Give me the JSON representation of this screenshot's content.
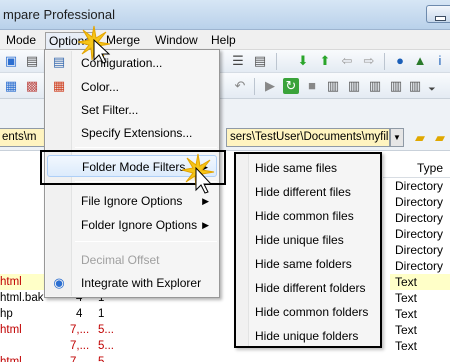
{
  "window": {
    "title": "mpare Professional"
  },
  "menubar": {
    "items": [
      {
        "label": "Mode",
        "active": false
      },
      {
        "label": "Options",
        "active": true
      },
      {
        "label": "Merge",
        "active": false
      },
      {
        "label": "Window",
        "active": false
      },
      {
        "label": "Help",
        "active": false
      }
    ]
  },
  "path": {
    "left": "ents\\m",
    "right": "sers\\TestUser\\Documents\\myfil"
  },
  "options_menu": {
    "items": [
      {
        "label": "Configuration...",
        "icon": "configuration-icon",
        "disabled": false
      },
      {
        "label": "Color...",
        "icon": "color-icon",
        "disabled": false
      },
      {
        "label": "Set Filter...",
        "icon": "",
        "disabled": false
      },
      {
        "label": "Specify Extensions...",
        "icon": "",
        "disabled": false
      },
      {
        "label": "Folder Mode Filters",
        "icon": "",
        "disabled": false,
        "submenu": true,
        "highlighted": true
      },
      {
        "label": "File Ignore Options",
        "icon": "",
        "disabled": false,
        "submenu": true
      },
      {
        "label": "Folder Ignore Options",
        "icon": "",
        "disabled": false,
        "submenu": true
      },
      {
        "label": "Decimal Offset",
        "icon": "",
        "disabled": true
      },
      {
        "label": "Integrate with Explorer",
        "icon": "explorer-integration-icon",
        "disabled": false
      }
    ]
  },
  "folder_mode_filters": {
    "items": [
      "Hide same files",
      "Hide different files",
      "Hide common files",
      "Hide unique files",
      "Hide same folders",
      "Hide different folders",
      "Hide common folders",
      "Hide unique folders"
    ]
  },
  "left_pane": {
    "rows": [
      {
        "name": "html",
        "col2": "",
        "col3": "",
        "color": "#c00000",
        "bg": "#ffffc8"
      },
      {
        "name": "html.bak",
        "col2": "4",
        "col3": "1",
        "color": "#000000",
        "bg": "#ffffff"
      },
      {
        "name": "hp",
        "col2": "4",
        "col3": "1",
        "color": "#000000",
        "bg": "#ffffff"
      },
      {
        "name": "html",
        "col2": "7,...",
        "col3": "5...",
        "color": "#c00000",
        "bg": "#ffffff"
      },
      {
        "name": "",
        "col2": "7,...",
        "col3": "5...",
        "color": "#c00000",
        "bg": "#ffffff"
      },
      {
        "name": "",
        "col2": "7,...",
        "col3": "5...",
        "color": "#c00000",
        "bg": "#ffffff"
      },
      {
        "name": "html",
        "col2": "",
        "col3": "",
        "color": "#c00000",
        "bg": "#ffffff"
      }
    ]
  },
  "right_pane": {
    "header": "Type",
    "rows": [
      "Directory",
      "Directory",
      "Directory",
      "Directory",
      "Directory",
      "Directory",
      "Text",
      "Text",
      "Text",
      "Text",
      "Text",
      "Text"
    ]
  }
}
